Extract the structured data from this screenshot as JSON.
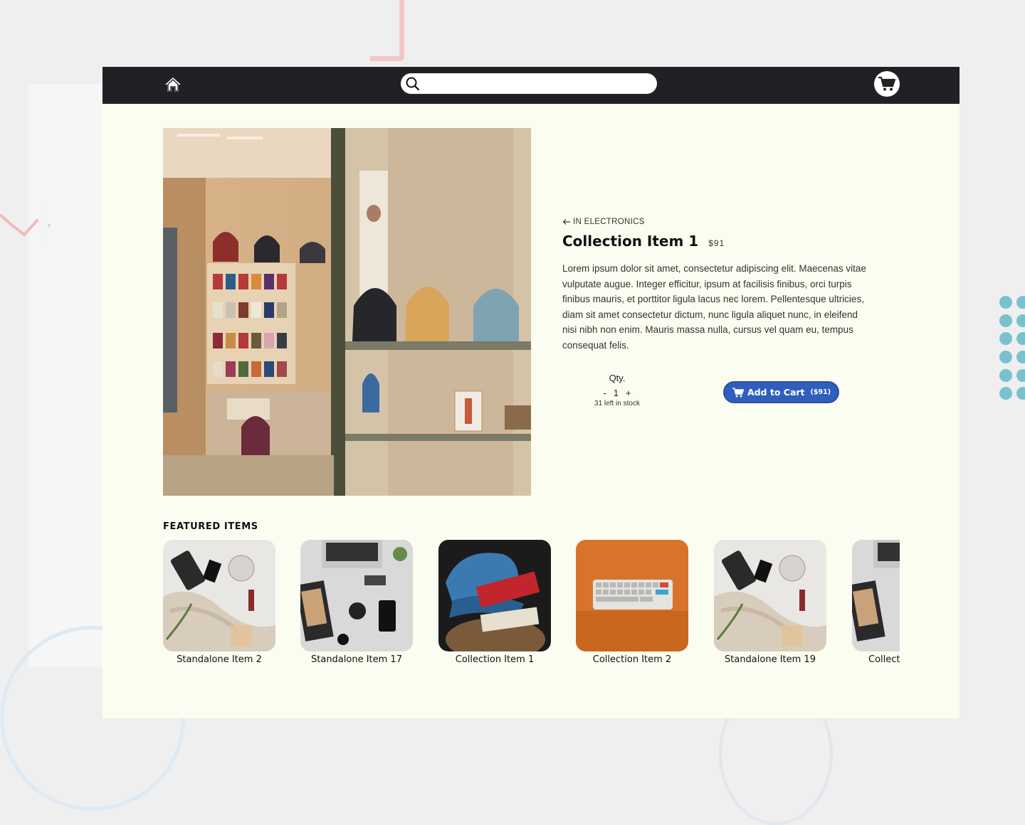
{
  "nav": {
    "search": {
      "placeholder": "",
      "value": ""
    },
    "home_icon": "home-icon",
    "cart_icon": "cart-icon"
  },
  "product": {
    "back_label": "IN ELECTRONICS",
    "title": "Collection Item 1",
    "price": "$91",
    "description": "Lorem ipsum dolor sit amet, consectetur adipiscing elit. Maecenas vitae vulputate augue. Integer efficitur, ipsum at facilisis finibus, orci turpis finibus mauris, et porttitor ligula lacus nec lorem. Pellentesque ultricies, diam sit amet consectetur dictum, nunc ligula aliquet nunc, in eleifend nisi nibh non enim. Mauris massa nulla, cursus vel quam eu, tempus consequat felis.",
    "qty_label": "Qty.",
    "qty_minus": "-",
    "qty_value": "1",
    "qty_plus": "+",
    "stock_text": "31 left in stock",
    "add_to_cart_label": "Add to Cart",
    "add_to_cart_price": "($91)"
  },
  "featured": {
    "heading": "FEATURED ITEMS",
    "items": [
      {
        "name": "Standalone Item 2"
      },
      {
        "name": "Standalone Item 17"
      },
      {
        "name": "Collection Item 1"
      },
      {
        "name": "Collection Item 2"
      },
      {
        "name": "Standalone Item 19"
      },
      {
        "name": "Collect"
      }
    ]
  },
  "colors": {
    "navbar": "#202124",
    "page_background": "#fbfdf0",
    "accent_button": "#2f5fbd"
  }
}
